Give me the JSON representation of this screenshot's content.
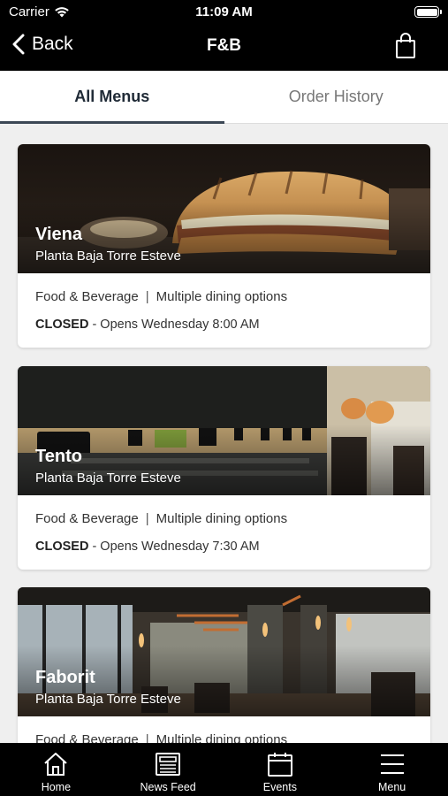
{
  "status_bar": {
    "carrier": "Carrier",
    "time": "11:09 AM"
  },
  "nav": {
    "back_label": "Back",
    "title": "F&B"
  },
  "tabs": [
    {
      "label": "All Menus",
      "active": true
    },
    {
      "label": "Order History",
      "active": false
    }
  ],
  "venues": [
    {
      "name": "Viena",
      "location": "Planta Baja Torre Esteve",
      "category": "Food & Beverage",
      "separator": "|",
      "options": "Multiple dining options",
      "status": "CLOSED",
      "status_detail": " - Opens Wednesday 8:00 AM"
    },
    {
      "name": "Tento",
      "location": "Planta Baja Torre Esteve",
      "category": "Food & Beverage",
      "separator": "|",
      "options": "Multiple dining options",
      "status": "CLOSED",
      "status_detail": " - Opens Wednesday 7:30 AM"
    },
    {
      "name": "Faborit",
      "location": "Planta Baja Torre Esteve",
      "category": "Food & Beverage",
      "separator": "|",
      "options": "Multiple dining options",
      "status": "",
      "status_detail": ""
    }
  ],
  "bottom_tabs": [
    {
      "label": "Home",
      "icon": "home-icon"
    },
    {
      "label": "News Feed",
      "icon": "news-feed-icon"
    },
    {
      "label": "Events",
      "icon": "calendar-icon"
    },
    {
      "label": "Menu",
      "icon": "hamburger-menu-icon"
    }
  ],
  "colors": {
    "bar_background": "#000000",
    "active_tab_text": "#1f2a36",
    "active_tab_underline": "#3b4755",
    "page_background": "#efefef"
  }
}
